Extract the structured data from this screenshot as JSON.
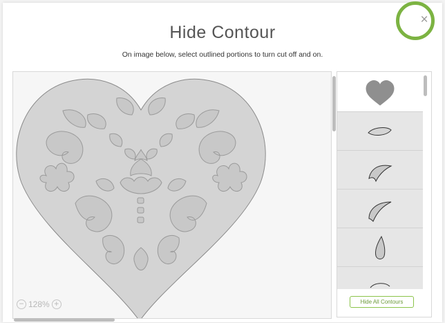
{
  "dialog": {
    "title": "Hide Contour",
    "subtitle": "On image below, select outlined portions to turn cut off and on.",
    "close_glyph": "×"
  },
  "canvas": {
    "zoom_level": "128%",
    "zoom_out_glyph": "−",
    "zoom_in_glyph": "+"
  },
  "contours_panel": {
    "items": [
      {
        "icon": "heart-icon"
      },
      {
        "icon": "petal-icon"
      },
      {
        "icon": "curved-leaf-icon"
      },
      {
        "icon": "curved-leaf-icon"
      },
      {
        "icon": "teardrop-icon"
      },
      {
        "icon": "petal-icon"
      }
    ],
    "hide_all_label": "Hide All Contours"
  },
  "colors": {
    "accent": "#7cb342",
    "shape_fill": "#d4d4d4",
    "shape_stroke": "#8a8a8a"
  }
}
